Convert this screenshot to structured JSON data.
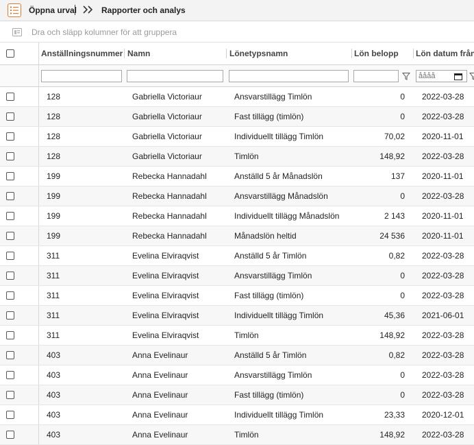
{
  "toolbar": {
    "open_label": "Öppna urval",
    "reports_label": "Rapporter och analys"
  },
  "groupbar": {
    "text": "Dra och släpp kolumner för att gruppera"
  },
  "columns": [
    "Anställningsnummer",
    "Namn",
    "Lönetypsnamn",
    "Lön belopp",
    "Lön datum från"
  ],
  "filters": {
    "date_placeholder": "åååå"
  },
  "rows": [
    [
      "128",
      "Gabriella Victoriaur",
      "Ansvarstillägg Timlön",
      "0",
      "2022-03-28"
    ],
    [
      "128",
      "Gabriella Victoriaur",
      "Fast tillägg (timlön)",
      "0",
      "2022-03-28"
    ],
    [
      "128",
      "Gabriella Victoriaur",
      "Individuellt tillägg Timlön",
      "70,02",
      "2020-11-01"
    ],
    [
      "128",
      "Gabriella Victoriaur",
      "Timlön",
      "148,92",
      "2022-03-28"
    ],
    [
      "199",
      "Rebecka Hannadahl",
      "Anställd 5 år Månadslön",
      "137",
      "2020-11-01"
    ],
    [
      "199",
      "Rebecka Hannadahl",
      "Ansvarstillägg Månadslön",
      "0",
      "2022-03-28"
    ],
    [
      "199",
      "Rebecka Hannadahl",
      "Individuellt tillägg Månadslön",
      "2 143",
      "2020-11-01"
    ],
    [
      "199",
      "Rebecka Hannadahl",
      "Månadslön heltid",
      "24 536",
      "2020-11-01"
    ],
    [
      "311",
      "Evelina Elviraqvist",
      "Anställd 5 år Timlön",
      "0,82",
      "2022-03-28"
    ],
    [
      "311",
      "Evelina Elviraqvist",
      "Ansvarstillägg Timlön",
      "0",
      "2022-03-28"
    ],
    [
      "311",
      "Evelina Elviraqvist",
      "Fast tillägg (timlön)",
      "0",
      "2022-03-28"
    ],
    [
      "311",
      "Evelina Elviraqvist",
      "Individuellt tillägg Timlön",
      "45,36",
      "2021-06-01"
    ],
    [
      "311",
      "Evelina Elviraqvist",
      "Timlön",
      "148,92",
      "2022-03-28"
    ],
    [
      "403",
      "Anna Evelinaur",
      "Anställd 5 år Timlön",
      "0,82",
      "2022-03-28"
    ],
    [
      "403",
      "Anna Evelinaur",
      "Ansvarstillägg Timlön",
      "0",
      "2022-03-28"
    ],
    [
      "403",
      "Anna Evelinaur",
      "Fast tillägg (timlön)",
      "0",
      "2022-03-28"
    ],
    [
      "403",
      "Anna Evelinaur",
      "Individuellt tillägg Timlön",
      "23,33",
      "2020-12-01"
    ],
    [
      "403",
      "Anna Evelinaur",
      "Timlön",
      "148,92",
      "2022-03-28"
    ]
  ]
}
